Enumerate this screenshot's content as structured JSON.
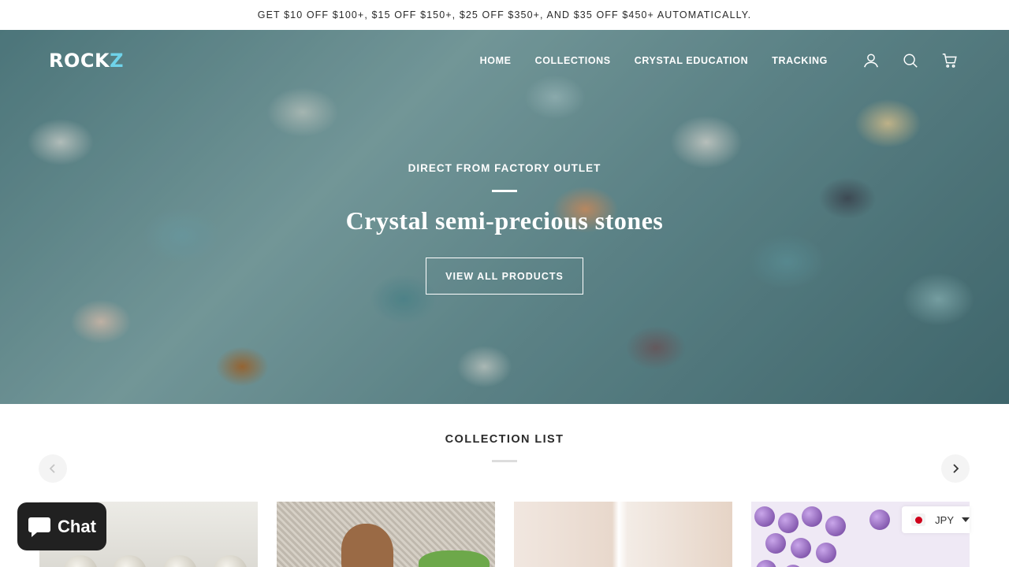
{
  "announcement": {
    "text": "GET $10 OFF $100+, $15 OFF $150+, $25 OFF $350+, AND $35 OFF $450+ AUTOMATICALLY."
  },
  "header": {
    "logo_text": "ROCK",
    "logo_accent": "Z",
    "nav": [
      {
        "label": "HOME"
      },
      {
        "label": "COLLECTIONS"
      },
      {
        "label": "CRYSTAL EDUCATION"
      },
      {
        "label": "TRACKING"
      }
    ],
    "icons": [
      "account-icon",
      "search-icon",
      "cart-icon"
    ]
  },
  "hero": {
    "eyebrow": "DIRECT FROM FACTORY OUTLET",
    "title": "Crystal semi-precious stones",
    "button_label": "VIEW ALL PRODUCTS"
  },
  "collections": {
    "title": "COLLECTION LIST",
    "prev_icon": "chevron-left-icon",
    "next_icon": "chevron-right-icon"
  },
  "chat": {
    "label": "Chat"
  },
  "currency": {
    "code": "JPY"
  },
  "colors": {
    "accent_logo": "#6fd3ea",
    "chat_bg": "#212121",
    "flag_red": "#d0021b"
  }
}
